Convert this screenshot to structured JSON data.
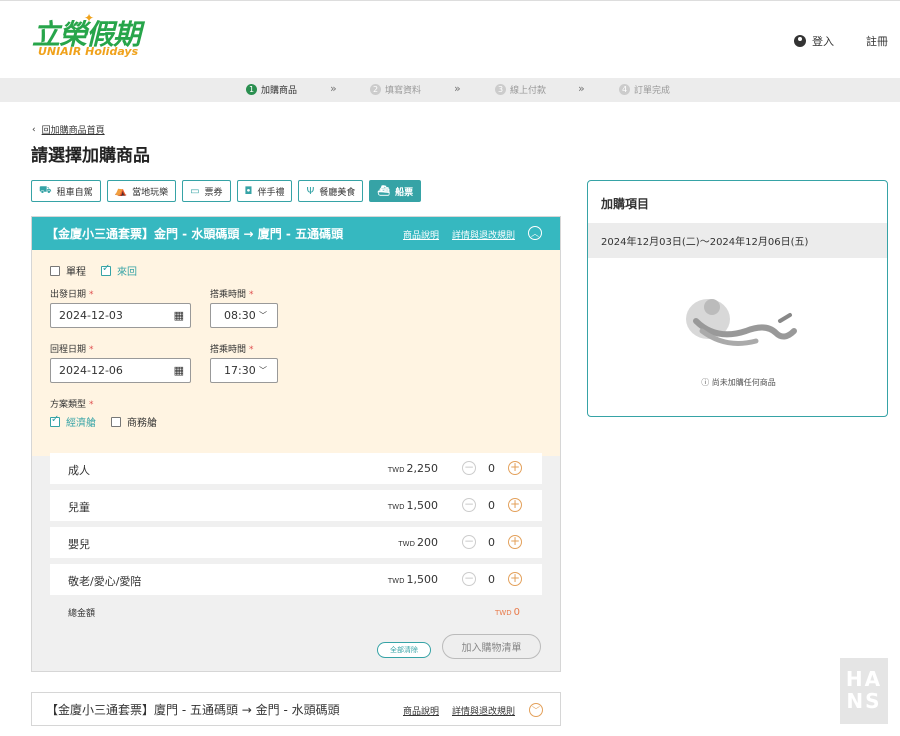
{
  "header": {
    "logo_zh": "立榮假期",
    "logo_en": "UNIAIR Holidays",
    "login": "登入",
    "register": "註冊"
  },
  "steps": [
    {
      "num": "1",
      "label": "加購商品"
    },
    {
      "num": "2",
      "label": "填寫資料"
    },
    {
      "num": "3",
      "label": "線上付款"
    },
    {
      "num": "4",
      "label": "訂單完成"
    }
  ],
  "page": {
    "back": "回加購商品首頁",
    "title": "請選擇加購商品"
  },
  "categories": [
    {
      "label": "租車自駕",
      "icon": "car-icon"
    },
    {
      "label": "當地玩樂",
      "icon": "ferris-wheel-icon"
    },
    {
      "label": "票券",
      "icon": "ticket-icon"
    },
    {
      "label": "伴手禮",
      "icon": "gift-bag-icon"
    },
    {
      "label": "餐廳美食",
      "icon": "cutlery-icon"
    },
    {
      "label": "船票",
      "icon": "ship-icon"
    }
  ],
  "product1": {
    "title": "【金廈小三通套票】金門 - 水頭碼頭 → 廈門 - 五通碼頭",
    "desc_link": "商品說明",
    "rules_link": "詳情與退改規則",
    "one_way": "單程",
    "round_trip": "來回",
    "depart_label": "出發日期",
    "depart_date": "2024-12-03",
    "depart_time_label": "搭乘時間",
    "depart_time": "08:30",
    "return_label": "回程日期",
    "return_date": "2024-12-06",
    "return_time_label": "搭乘時間",
    "return_time": "17:30",
    "plan_label": "方案類型",
    "economy": "經濟艙",
    "business": "商務艙",
    "req": "*",
    "passengers": [
      {
        "name": "成人",
        "currency": "TWD",
        "price": "2,250",
        "qty": "0"
      },
      {
        "name": "兒童",
        "currency": "TWD",
        "price": "1,500",
        "qty": "0"
      },
      {
        "name": "嬰兒",
        "currency": "TWD",
        "price": "200",
        "qty": "0"
      },
      {
        "name": "敬老/愛心/愛陪",
        "currency": "TWD",
        "price": "1,500",
        "qty": "0"
      }
    ],
    "total_label": "總金額",
    "total_currency": "TWD",
    "total_value": "0",
    "clear_all": "全部清除",
    "add_to_cart": "加入購物清單"
  },
  "product2": {
    "title": "【金廈小三通套票】廈門 - 五通碼頭 → 金門 - 水頭碼頭",
    "desc_link": "商品說明",
    "rules_link": "詳情與退改規則"
  },
  "sidebar": {
    "title": "加購項目",
    "date_range": "2024年12月03日(二)～2024年12月06日(五)",
    "empty_text": "尚未加購任何商品"
  },
  "watermark": {
    "text1": "HA",
    "text2": "NS"
  },
  "colors": {
    "teal": "#36b8c0",
    "brand_green": "#27a54a",
    "brand_orange": "#f0a21c",
    "cream": "#fff4e2"
  }
}
